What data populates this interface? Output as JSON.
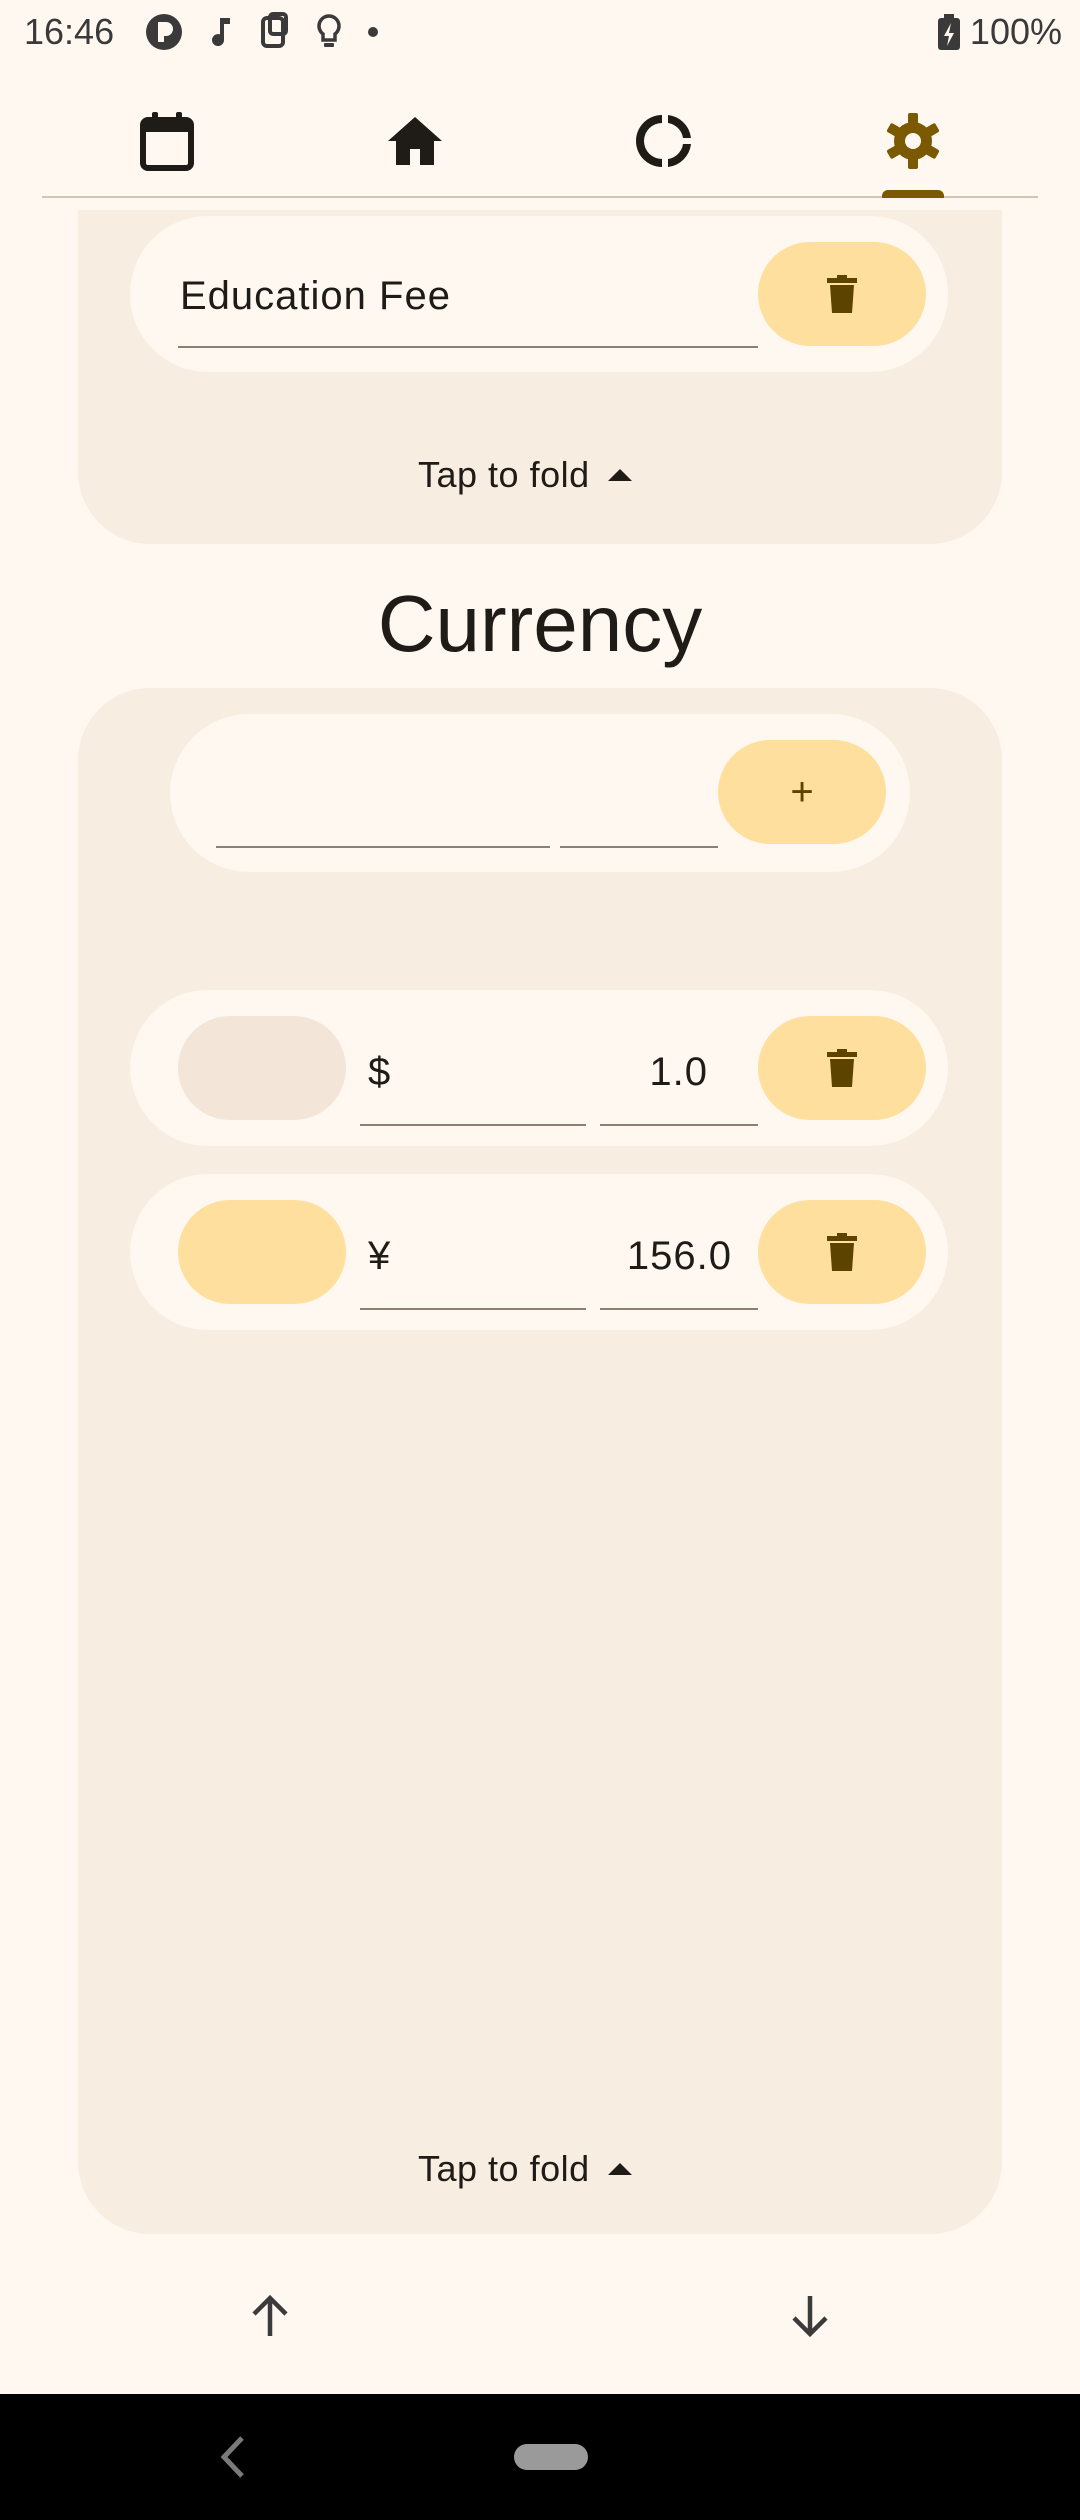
{
  "status_bar": {
    "time": "16:46",
    "battery": "100%",
    "icons": [
      "app-icon",
      "music-icon",
      "file-icon",
      "lightbulb-icon",
      "dot-icon",
      "battery-icon"
    ]
  },
  "tabs": [
    {
      "name": "calendar",
      "icon": "calendar-icon",
      "active": false
    },
    {
      "name": "home",
      "icon": "home-icon",
      "active": false
    },
    {
      "name": "stats",
      "icon": "donut-chart-icon",
      "active": false
    },
    {
      "name": "settings",
      "icon": "gear-icon",
      "active": true
    }
  ],
  "categories_panel": {
    "item": {
      "value": "Education Fee"
    },
    "fold_label": "Tap to fold"
  },
  "currency": {
    "title": "Currency",
    "new_row": {
      "name_value": "",
      "rate_value": "",
      "add_label": "+"
    },
    "items": [
      {
        "symbol": "$",
        "rate": "1.0",
        "selected": false
      },
      {
        "symbol": "¥",
        "rate": "156.0",
        "selected": true
      }
    ],
    "fold_label": "Tap to fold"
  },
  "colors": {
    "background": "#fff8f1",
    "panel": "#f8ede1",
    "accent": "#7a5900",
    "pill": "#fedf9e",
    "text": "#1f1b16"
  }
}
